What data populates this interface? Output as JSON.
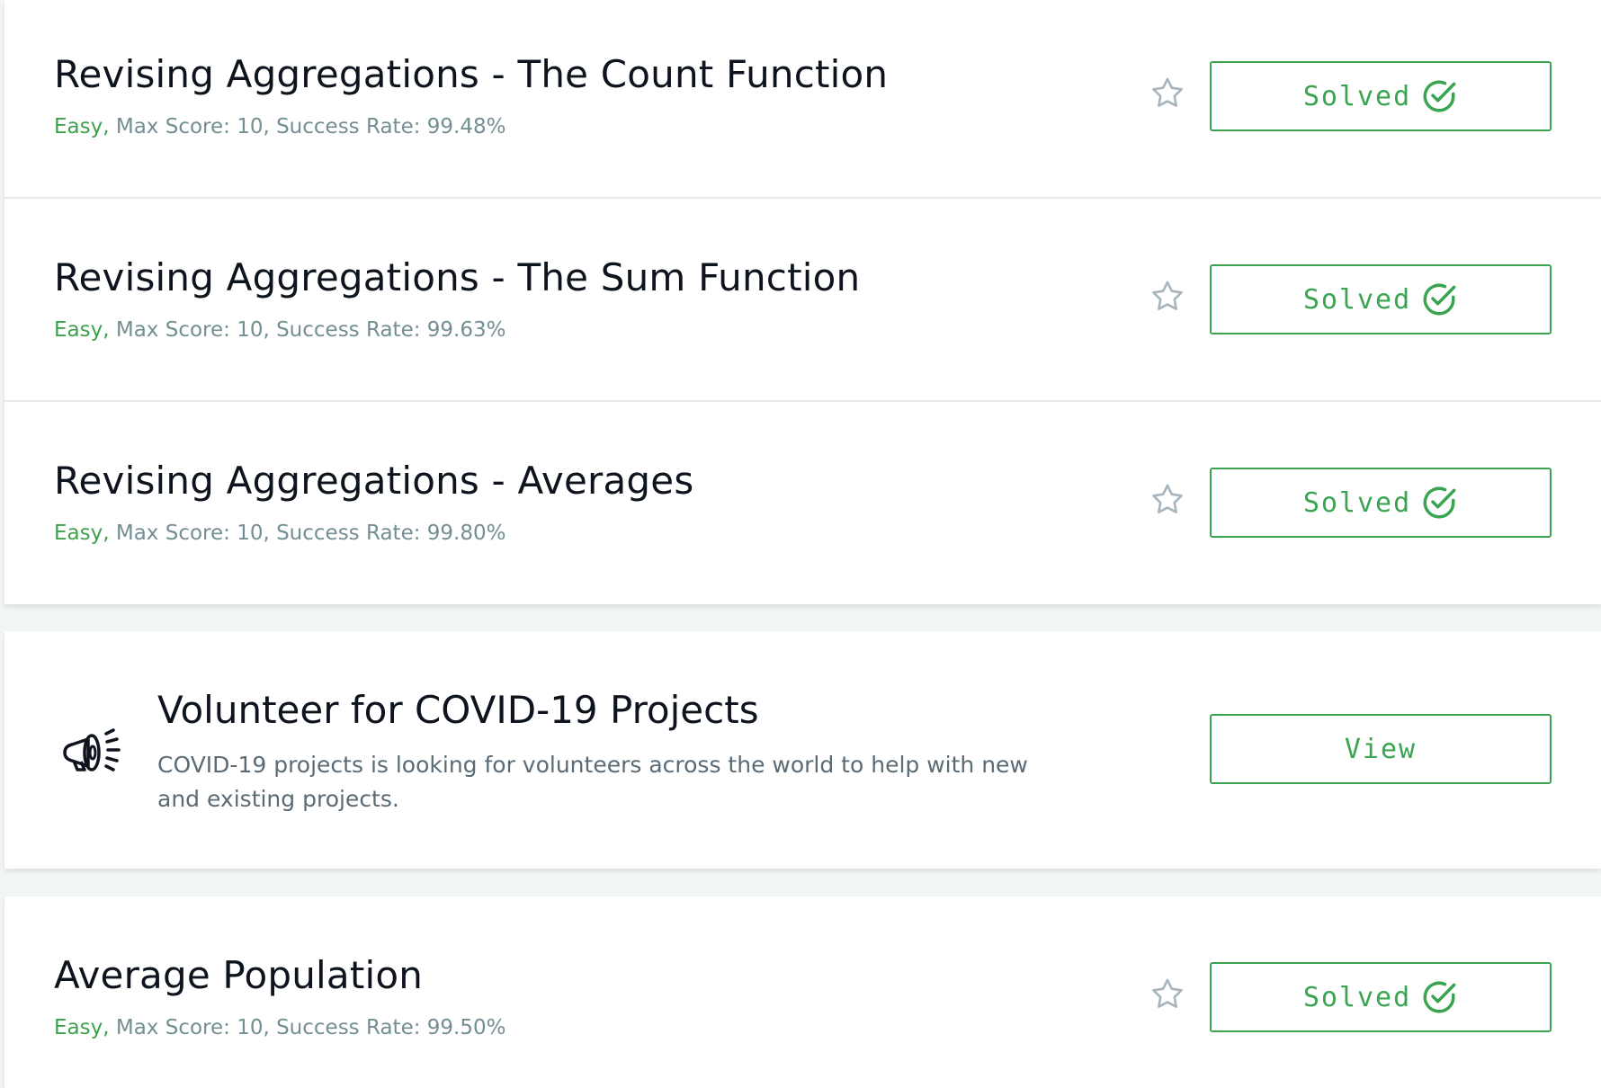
{
  "challenges": [
    {
      "title": "Revising Aggregations - The Count Function",
      "difficulty": "Easy,",
      "details": " Max Score: 10, Success Rate: 99.48%",
      "button_label": "Solved"
    },
    {
      "title": "Revising Aggregations - The Sum Function",
      "difficulty": "Easy,",
      "details": " Max Score: 10, Success Rate: 99.63%",
      "button_label": "Solved"
    },
    {
      "title": "Revising Aggregations - Averages",
      "difficulty": "Easy,",
      "details": " Max Score: 10, Success Rate: 99.80%",
      "button_label": "Solved"
    },
    {
      "title": "Average Population",
      "difficulty": "Easy,",
      "details": " Max Score: 10, Success Rate: 99.50%",
      "button_label": "Solved"
    }
  ],
  "promo": {
    "icon": "megaphone-icon",
    "title": "Volunteer for COVID-19 Projects",
    "description": "COVID-19 projects is looking for volunteers across the world to help with new and existing projects.",
    "button_label": "View"
  },
  "colors": {
    "accent_green": "#39a550",
    "difficulty_green": "#3fa14d",
    "meta_gray": "#738f93",
    "title_dark": "#0e141e",
    "page_bg": "#f3f6f7"
  }
}
